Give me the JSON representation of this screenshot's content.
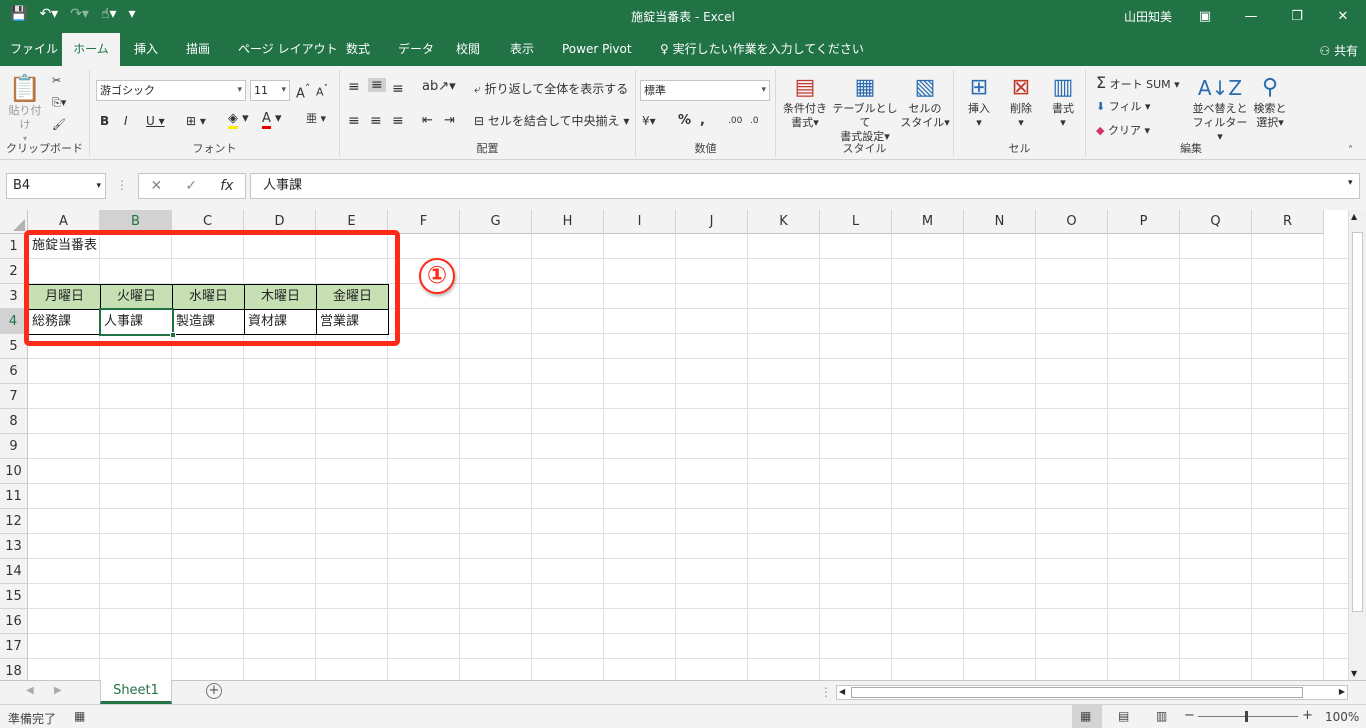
{
  "window": {
    "title": "施錠当番表  -  Excel",
    "user": "山田知美"
  },
  "tabs": [
    "ファイル",
    "ホーム",
    "挿入",
    "描画",
    "ページ レイアウト",
    "数式",
    "データ",
    "校閲",
    "表示",
    "Power Pivot"
  ],
  "tell_me": "実行したい作業を入力してください",
  "share_label": "共有",
  "ribbon": {
    "clipboard": {
      "paste": "貼り付け",
      "label": "クリップボード"
    },
    "font": {
      "name": "游ゴシック",
      "size": "11",
      "label": "フォント"
    },
    "alignment": {
      "wrap": "折り返して全体を表示する",
      "merge": "セルを結合して中央揃え",
      "label": "配置"
    },
    "number": {
      "format": "標準",
      "label": "数値"
    },
    "styles": {
      "conditional_1": "条件付き",
      "conditional_2": "書式",
      "table_1": "テーブルとして",
      "table_2": "書式設定",
      "cell_1": "セルの",
      "cell_2": "スタイル",
      "label": "スタイル"
    },
    "cells": {
      "insert": "挿入",
      "delete": "削除",
      "format": "書式",
      "label": "セル"
    },
    "editing": {
      "autosum": "オート SUM",
      "fill": "フィル",
      "clear": "クリア",
      "sort_1": "並べ替えと",
      "sort_2": "フィルター",
      "find_1": "検索と",
      "find_2": "選択",
      "label": "編集"
    }
  },
  "formula_bar": {
    "name_box": "B4",
    "value": "人事課"
  },
  "columns": [
    "A",
    "B",
    "C",
    "D",
    "E",
    "F",
    "G",
    "H",
    "I",
    "J",
    "K",
    "L",
    "M",
    "N",
    "O",
    "P",
    "Q",
    "R"
  ],
  "rows": [
    "1",
    "2",
    "3",
    "4",
    "5",
    "6",
    "7",
    "8",
    "9",
    "10",
    "11",
    "12",
    "13",
    "14",
    "15",
    "16",
    "17",
    "18"
  ],
  "cells": {
    "A1": "施錠当番表",
    "A3": "月曜日",
    "B3": "火曜日",
    "C3": "水曜日",
    "D3": "木曜日",
    "E3": "金曜日",
    "A4": "総務課",
    "B4": "人事課",
    "C4": "製造課",
    "D4": "資材課",
    "E4": "営業課"
  },
  "annotation": {
    "number": "①"
  },
  "sheet_tab": "Sheet1",
  "status": {
    "ready": "準備完了",
    "zoom": "100%"
  },
  "colors": {
    "excel_green": "#217346",
    "header_fill": "#c6e0b4",
    "highlight_red": "#ff2a1a"
  }
}
